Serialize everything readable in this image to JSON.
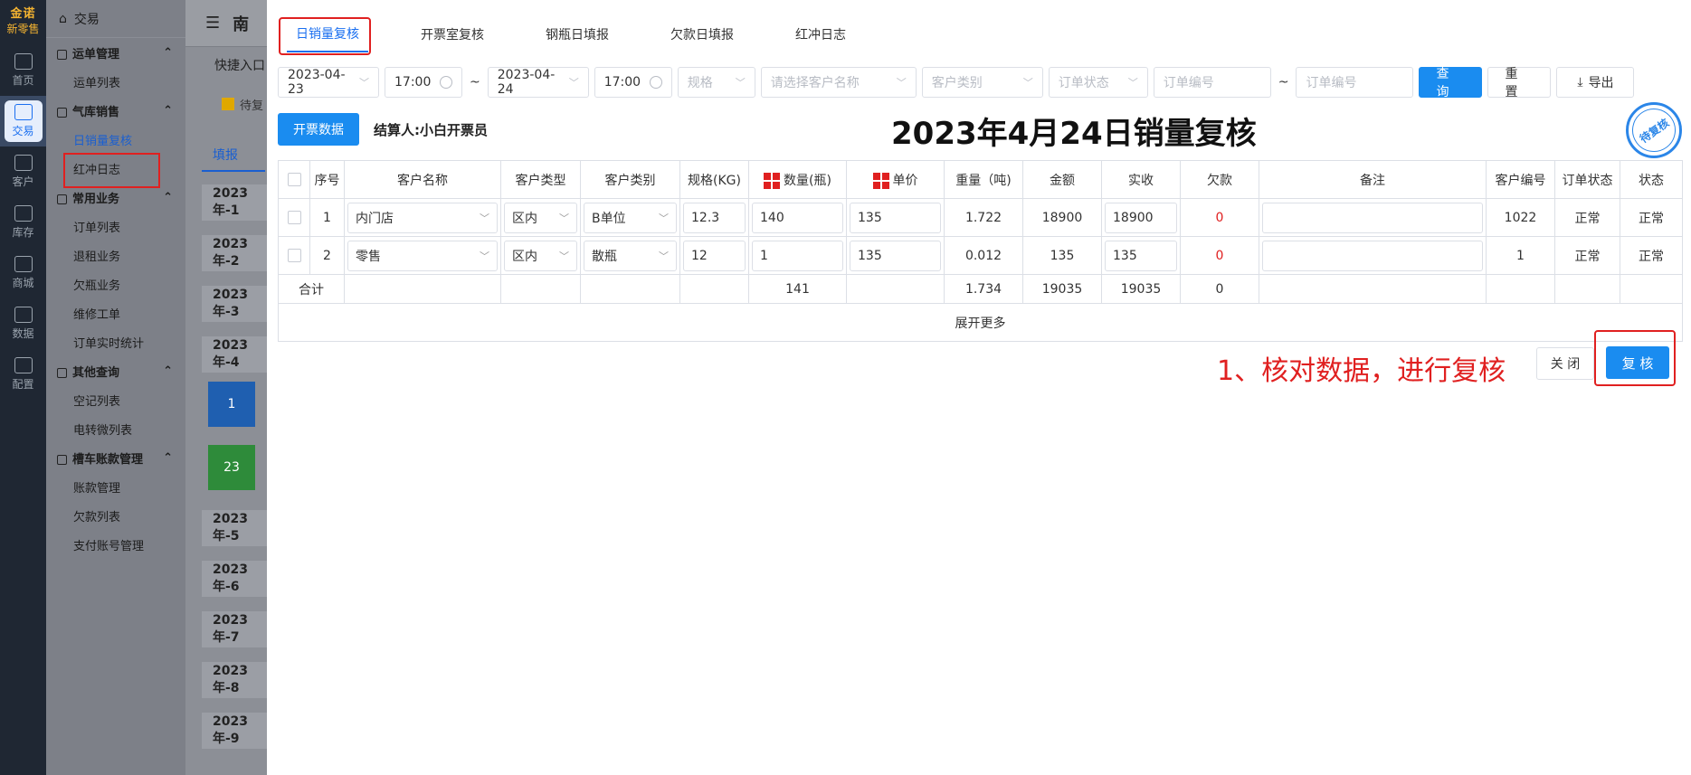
{
  "rail": {
    "logo_line1": "金诺",
    "logo_line2": "新零售",
    "items": [
      {
        "label": "首页"
      },
      {
        "label": "交易"
      },
      {
        "label": "客户"
      },
      {
        "label": "库存"
      },
      {
        "label": "商城"
      },
      {
        "label": "数据"
      },
      {
        "label": "配置"
      }
    ]
  },
  "submenu": {
    "head": "交易",
    "group1": "运单管理",
    "item_waybill_list": "运单列表",
    "group2": "气库销售",
    "item_daily_review": "日销量复核",
    "item_red_log": "红冲日志",
    "group3": "常用业务",
    "item_order_list": "订单列表",
    "item_return": "退租业务",
    "item_owed_bottle": "欠瓶业务",
    "item_repair": "维修工单",
    "item_order_stats": "订单实时统计",
    "group4": "其他查询",
    "item_empty_list": "空记列表",
    "item_transfer_list": "电转微列表",
    "group5": "槽车账款管理",
    "item_account": "账款管理",
    "item_debt_list": "欠款列表",
    "item_pay_account": "支付账号管理"
  },
  "bg": {
    "title": "南",
    "quick": "快捷入口",
    "pending": "待复",
    "tab": "填报",
    "dates": [
      "2023年-1",
      "2023年-2",
      "2023年-3",
      "2023年-4",
      "2023年-5",
      "2023年-6",
      "2023年-7",
      "2023年-8",
      "2023年-9"
    ],
    "tile1": "1",
    "tile2": "23"
  },
  "tabs": [
    "日销量复核",
    "开票室复核",
    "钢瓶日填报",
    "欠款日填报",
    "红冲日志"
  ],
  "filters": {
    "date_from": "2023-04-23",
    "time_from": "17:00",
    "sep": "~",
    "date_to": "2023-04-24",
    "time_to": "17:00",
    "spec_ph": "规格",
    "customer_ph": "请选择客户名称",
    "cust_category_ph": "客户类别",
    "order_status_ph": "订单状态",
    "order_no_ph1": "订单编号",
    "order_no_ph2": "订单编号",
    "query": "查 询",
    "reset": "重 置",
    "export": "导出"
  },
  "actions": {
    "invoice_data": "开票数据",
    "settler": "结算人:小白开票员"
  },
  "page_title": "2023年4月24日销量复核",
  "stamp": "待复核",
  "table": {
    "headers": [
      "序号",
      "客户名称",
      "客户类型",
      "客户类别",
      "规格(KG)",
      "数量(瓶)",
      "单价",
      "重量（吨)",
      "金额",
      "实收",
      "欠款",
      "备注",
      "客户编号",
      "订单状态",
      "状态"
    ],
    "rows": [
      {
        "no": "1",
        "name": "内门店",
        "type": "区内",
        "category": "B单位",
        "spec": "12.3",
        "qty": "140",
        "price": "135",
        "weight": "1.722",
        "amount": "18900",
        "received": "18900",
        "debt": "0",
        "note": "",
        "cust_no": "1022",
        "order_status": "正常",
        "status": "正常"
      },
      {
        "no": "2",
        "name": "零售",
        "type": "区内",
        "category": "散瓶",
        "spec": "12",
        "qty": "1",
        "price": "135",
        "weight": "0.012",
        "amount": "135",
        "received": "135",
        "debt": "0",
        "note": "",
        "cust_no": "1",
        "order_status": "正常",
        "status": "正常"
      }
    ],
    "sum": {
      "label": "合计",
      "qty": "141",
      "weight": "1.734",
      "amount": "19035",
      "received": "19035",
      "debt": "0"
    },
    "expand": "展开更多"
  },
  "instruction": "1、核对数据，进行复核",
  "buttons": {
    "close": "关 闭",
    "review": "复 核"
  }
}
